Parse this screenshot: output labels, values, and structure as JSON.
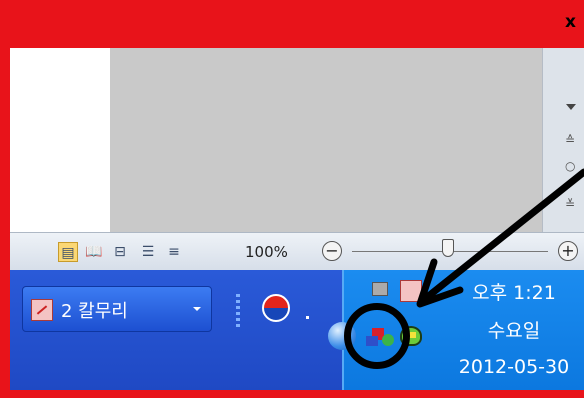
{
  "window": {
    "close_glyph": "x",
    "frame_color": "#e8131a"
  },
  "scrollbar": {
    "down_arrow_icon": "arrow-down-icon",
    "prev_page_icon": "chevron-double-up-icon",
    "next_page_icon": "chevron-double-down-icon"
  },
  "statusbar": {
    "view_buttons": [
      {
        "name": "print-layout",
        "glyph": "▤",
        "active": true
      },
      {
        "name": "full-screen-reading",
        "glyph": "📖",
        "active": false
      },
      {
        "name": "web-layout",
        "glyph": "⊟",
        "active": false
      },
      {
        "name": "outline",
        "glyph": "☰",
        "active": false
      },
      {
        "name": "draft",
        "glyph": "≡",
        "active": false
      }
    ],
    "zoom_label": "100%",
    "zoom_minus": "−",
    "zoom_plus": "+"
  },
  "taskbar": {
    "task_button": {
      "label": "2 칼무리",
      "icon": "pdf-app-icon"
    },
    "language_icon": "korean-ime-icon"
  },
  "tray": {
    "time": "오후 1:21",
    "day": "수요일",
    "date": "2012-05-30"
  },
  "colors": {
    "taskbar": "#1f49c4",
    "tray": "#0c78df",
    "annotation": "#000000"
  }
}
